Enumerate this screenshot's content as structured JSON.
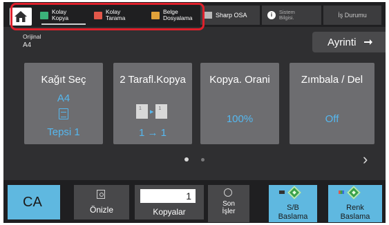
{
  "top_bar": {
    "tabs": [
      {
        "label": "Kolay\nKopya",
        "icon": "copy-icon",
        "active": true
      },
      {
        "label": "Kolay\nTarama",
        "icon": "scan-icon",
        "active": false
      },
      {
        "label": "Belge\nDosyalama",
        "icon": "folder-icon",
        "active": false
      }
    ],
    "osa_label": "Sharp OSA",
    "info_label": "Sistem\nBilgisi.",
    "status_label": "İş Durumu"
  },
  "original": {
    "label": "Orijinal",
    "size": "A4"
  },
  "detail_label": "Ayrinti",
  "tiles": [
    {
      "title": "Kağıt Seç",
      "value": "A4",
      "sub": "Tepsi 1",
      "icon": "paper-tray-icon"
    },
    {
      "title": "2 Tarafl.Kopya",
      "value": "1 → 1",
      "icon": "duplex-icon"
    },
    {
      "title": "Kopya. Orani",
      "value": "100%"
    },
    {
      "title": "Zımbala / Del",
      "value": "Off"
    }
  ],
  "pagination": {
    "current_page": 1,
    "total_pages": 2
  },
  "bottom_bar": {
    "ca_label": "CA",
    "preview_label": "Önizle",
    "copies_value": "1",
    "copies_label": "Kopyalar",
    "recent_label": "Son\nİşler",
    "start_bw_label": "S/B\nBaslama",
    "start_color_label": "Renk\nBaslama"
  },
  "colors": {
    "accent": "#5fb8e0",
    "value_text": "#55b8f0",
    "highlight": "#e0202b",
    "tile_bg": "#6d6d70"
  }
}
